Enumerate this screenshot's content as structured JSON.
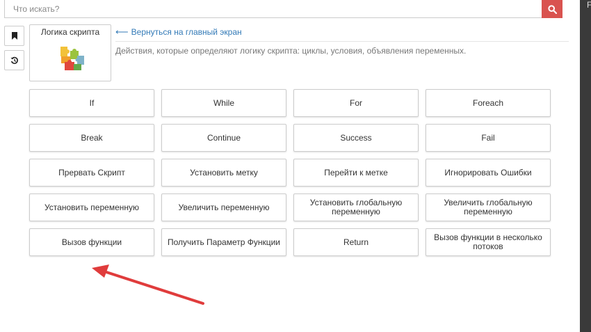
{
  "search": {
    "placeholder": "Что искать?",
    "button_icon": "search-icon",
    "button_color": "#d9534f"
  },
  "sidebar": {
    "buttons": [
      {
        "icon": "bookmark-icon"
      },
      {
        "icon": "history-icon"
      }
    ]
  },
  "category": {
    "title": "Логика скрипта",
    "icon": "puzzle-icon",
    "back_link": "Вернуться на главный экран",
    "description": "Действия, которые определяют логику скрипта: циклы, условия, объявления переменных."
  },
  "actions": [
    "If",
    "While",
    "For",
    "Foreach",
    "Break",
    "Continue",
    "Success",
    "Fail",
    "Прервать Скрипт",
    "Установить метку",
    "Перейти к метке",
    "Игнорировать Ошибки",
    "Установить переменную",
    "Увеличить переменную",
    "Установить глобальную переменную",
    "Увеличить глобальную переменную",
    "Вызов функции",
    "Получить Параметр Функции",
    "Return",
    "Вызов функции в несколько потоков"
  ],
  "annotation": {
    "color": "#e03c3c"
  },
  "right_strip": {
    "glyph": "F"
  }
}
